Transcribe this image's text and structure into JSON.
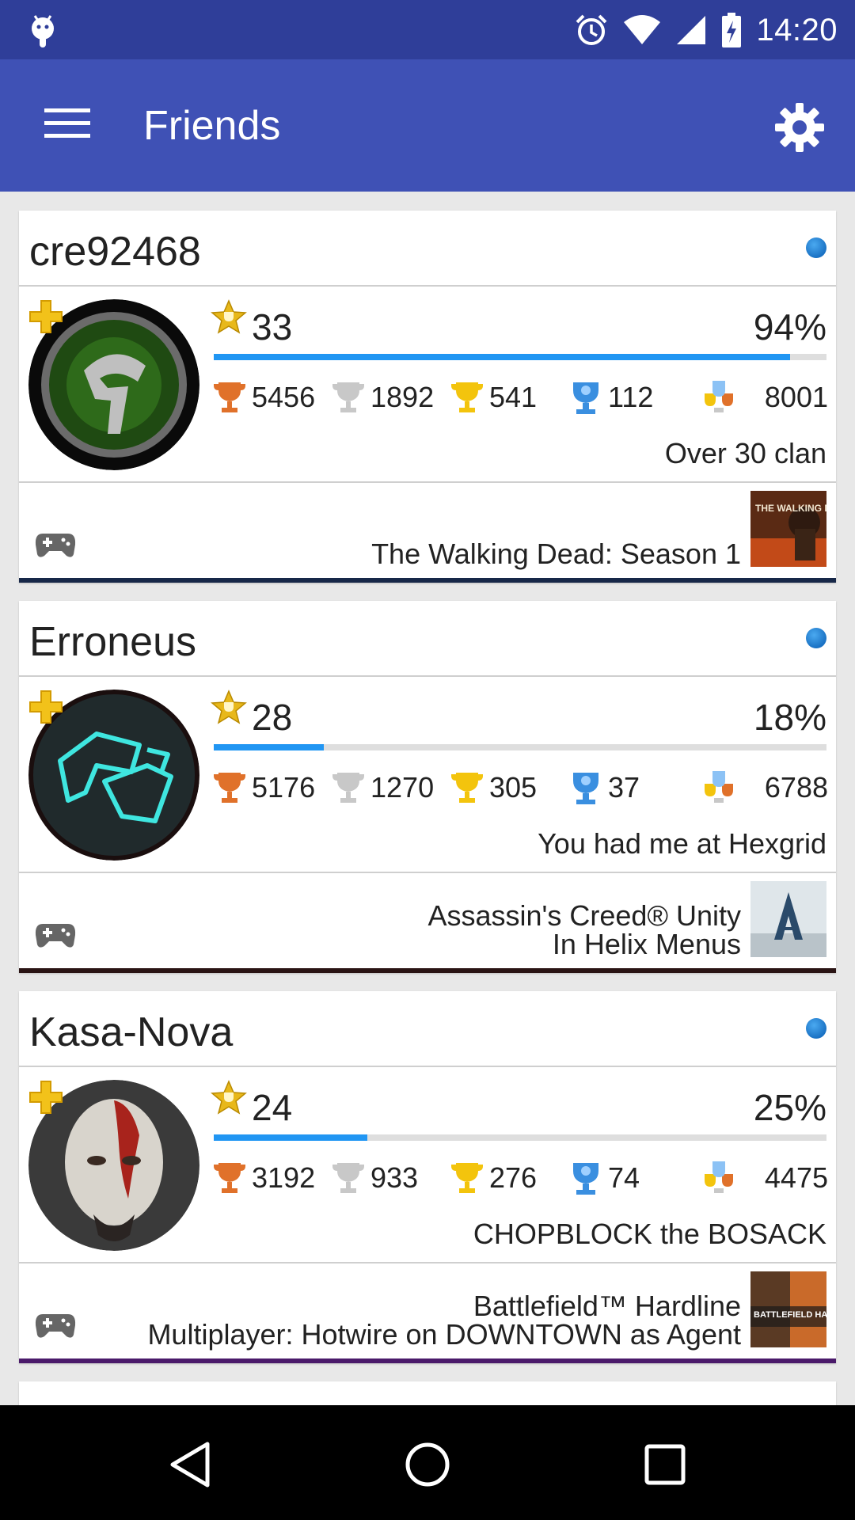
{
  "status_bar": {
    "time": "14:20"
  },
  "app_bar": {
    "title": "Friends"
  },
  "colors": {
    "status_bar": "#2f3e99",
    "app_bar": "#3f51b5",
    "progress": "#2196f3",
    "online": "#1a72c4",
    "bronze": "#e0712a",
    "silver": "#c8c8c8",
    "gold": "#f3c40d",
    "platinum": "#3a8fe0"
  },
  "friends": [
    {
      "username": "cre92468",
      "level": "33",
      "progress_pct": "94%",
      "progress": 0.94,
      "bronze": "5456",
      "silver": "1892",
      "gold": "541",
      "platinum": "112",
      "total": "8001",
      "about": "Over 30 clan",
      "presence_line1": "The Walking Dead: Season 1",
      "presence_line2": "",
      "bottom_color": "#172848",
      "avatar_icon": "helmet-emblem-icon",
      "game_icon": "walking-dead-cover",
      "game_thumb_text": "THE WALKING DEAD"
    },
    {
      "username": "Erroneus",
      "level": "28",
      "progress_pct": "18%",
      "progress": 0.18,
      "bronze": "5176",
      "silver": "1270",
      "gold": "305",
      "platinum": "37",
      "total": "6788",
      "about": "You had me at Hexgrid",
      "presence_line1": "Assassin's Creed® Unity",
      "presence_line2": "In Helix Menus",
      "bottom_color": "#2a1414",
      "avatar_icon": "neon-emblem-icon",
      "game_icon": "assassins-creed-cover",
      "game_thumb_text": ""
    },
    {
      "username": "Kasa-Nova",
      "level": "24",
      "progress_pct": "25%",
      "progress": 0.25,
      "bronze": "3192",
      "silver": "933",
      "gold": "276",
      "platinum": "74",
      "total": "4475",
      "about": "CHOPBLOCK the BOSACK",
      "presence_line1": "Battlefield™ Hardline",
      "presence_line2": "Multiplayer: Hotwire on DOWNTOWN as Agent",
      "bottom_color": "#4a1a6a",
      "avatar_icon": "kratos-face-icon",
      "game_icon": "battlefield-cover",
      "game_thumb_text": "BATTLEFIELD HARDLINE"
    }
  ]
}
